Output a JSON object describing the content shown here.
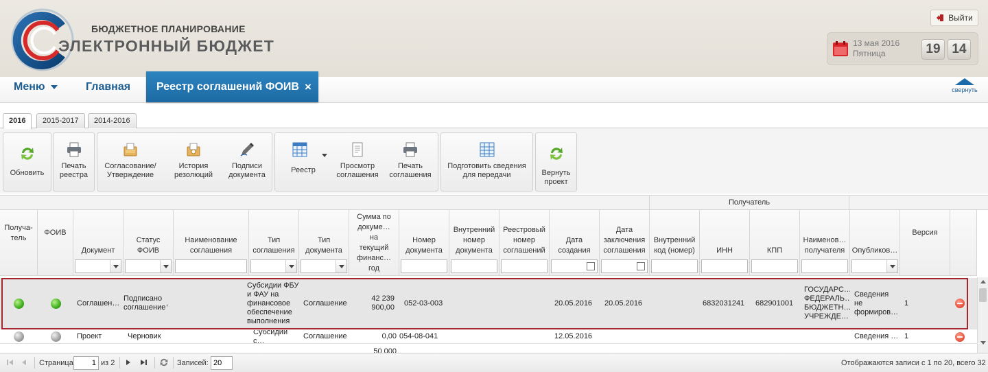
{
  "header": {
    "brand_top": "БЮДЖЕТНОЕ ПЛАНИРОВАНИЕ",
    "brand_bottom": "ЭЛЕКТРОННЫЙ БЮДЖЕТ",
    "logout_label": "Выйти",
    "date": "13 мая 2016",
    "weekday": "Пятница",
    "clock_hours": "19",
    "clock_minutes": "14"
  },
  "nav": {
    "menu_label": "Меню",
    "home_label": "Главная",
    "active_tab_label": "Реестр соглашений ФОИВ",
    "close_glyph": "×",
    "collapse_label": "свернуть"
  },
  "year_tabs": [
    "2016",
    "2015-2017",
    "2014-2016"
  ],
  "toolbar": {
    "refresh": "Обновить",
    "print_registry": "Печать\nреестра",
    "approval": "Согласование/\nУтверждение",
    "resolution_history": "История\nрезолюций",
    "document_signatures": "Подписи\nдокумента",
    "registry": "Реестр",
    "view_agreement": "Просмотр\nсоглашения",
    "print_agreement": "Печать\nсоглашения",
    "prepare_transfer": "Подготовить сведения\nдля передачи",
    "return_project": "Вернуть\nпроект"
  },
  "grid": {
    "group_header": "Получатель",
    "columns": [
      "Получа-\nтель",
      "ФОИВ",
      "Документ",
      "Статус\nФОИВ",
      "Наименование\nсоглашения",
      "Тип\nсоглашения",
      "Тип\nдокумента",
      "Сумма по\nдокуме…\nна\nтекущий\nфинанс…\nгод",
      "Номер\nдокумента",
      "Внутренний\nномер\nдокумента",
      "Реестровый\nномер\nсоглашений",
      "Дата\nсоздания",
      "Дата\nзаключения\nсоглашения",
      "Внутренний\nкод (номер)",
      "ИНН",
      "КПП",
      "Наименов…\nполучателя",
      "Опубликов…",
      "Версия"
    ],
    "rows": [
      {
        "document": "Соглашен…",
        "status": "Подписано\nсоглашение",
        "status_mark": ",",
        "agreement_type": "Субсидии ФБУ\nи ФАУ на\nфинансовое\nобеспечение\nвыполнения",
        "doc_type": "Соглашение",
        "amount": "42 239\n900,00",
        "doc_number": "052-03-003",
        "created": "20.05.2016",
        "concluded": "20.05.2016",
        "inn": "6832031241",
        "kpp": "682901001",
        "recipient_name": "ГОСУДАРС…\nФЕДЕРАЛЬ…\nБЮДЖЕТН…\nУЧРЕЖДЕ…",
        "published": "Сведения\nне\nформиров…",
        "version": "1"
      },
      {
        "document": "Проект",
        "status": "Черновик",
        "agreement_type": "Субсидии с…",
        "doc_type": "Соглашение",
        "amount": "0,00",
        "doc_number": "054-08-041",
        "created": "12.05.2016",
        "published": "Сведения …",
        "version": "1"
      },
      {
        "amount": "50 000"
      }
    ]
  },
  "pager": {
    "page_label": "Страница",
    "page_value": "1",
    "of_label": "из 2",
    "records_label": "Записей:",
    "records_value": "20",
    "summary": "Отображаются записи с 1 по 20, всего 32"
  },
  "colors": {
    "accent": "#1d6aa4",
    "highlight_border": "#a4262c",
    "status_green": "#3fae1c"
  }
}
